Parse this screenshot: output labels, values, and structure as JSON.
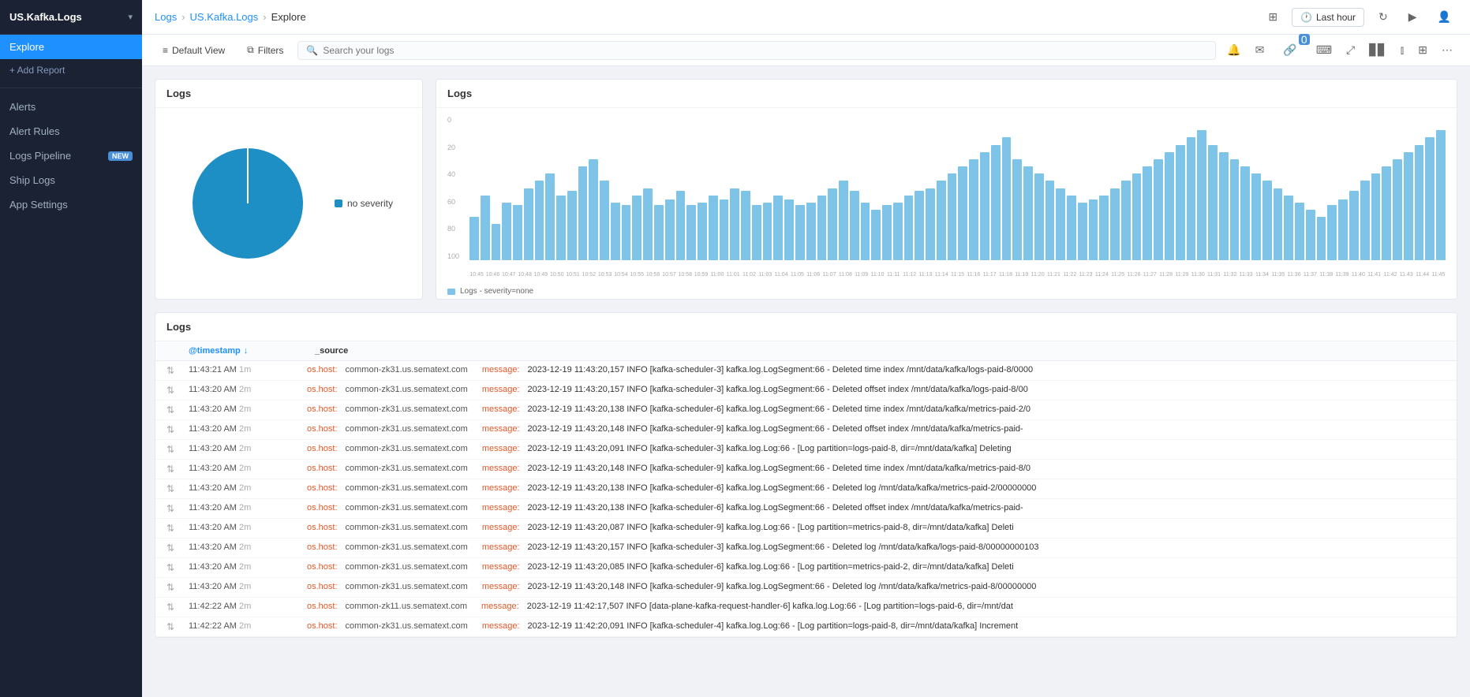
{
  "sidebar": {
    "title": "US.Kafka.Logs",
    "chevron": "▾",
    "active_item": "Explore",
    "add_report": "+ Add Report",
    "nav_items": [
      {
        "label": "Alerts",
        "badge": null
      },
      {
        "label": "Alert Rules",
        "badge": null
      },
      {
        "label": "Logs Pipeline",
        "badge": "NEW"
      },
      {
        "label": "Ship Logs",
        "badge": null
      },
      {
        "label": "App Settings",
        "badge": null
      }
    ]
  },
  "breadcrumb": {
    "logs": "Logs",
    "us_kafka": "US.Kafka.Logs",
    "current": "Explore"
  },
  "topbar_right": {
    "time_filter": "Last hour",
    "refresh_icon": "↻",
    "play_icon": "▶",
    "more_icon": "⋯"
  },
  "toolbar": {
    "default_view": "Default View",
    "filters": "Filters",
    "search_placeholder": "Search your logs"
  },
  "pie_chart": {
    "title": "Logs",
    "legend": [
      {
        "label": "no severity",
        "color": "#1e8fc4"
      }
    ]
  },
  "bar_chart": {
    "title": "Logs",
    "y_labels": [
      "0",
      "20",
      "40",
      "60",
      "80",
      "100"
    ],
    "legend": "Logs - severity=none",
    "bars": [
      30,
      45,
      25,
      40,
      38,
      50,
      55,
      60,
      45,
      48,
      65,
      70,
      55,
      40,
      38,
      45,
      50,
      38,
      42,
      48,
      38,
      40,
      45,
      42,
      50,
      48,
      38,
      40,
      45,
      42,
      38,
      40,
      45,
      50,
      55,
      48,
      40,
      35,
      38,
      40,
      45,
      48,
      50,
      55,
      60,
      65,
      70,
      75,
      80,
      85,
      70,
      65,
      60,
      55,
      50,
      45,
      40,
      42,
      45,
      50,
      55,
      60,
      65,
      70,
      75,
      80,
      85,
      90,
      80,
      75,
      70,
      65,
      60,
      55,
      50,
      45,
      40,
      35,
      30,
      38,
      42,
      48,
      55,
      60,
      65,
      70,
      75,
      80,
      85,
      90
    ],
    "x_labels": [
      "10:45",
      "10:46",
      "10:47",
      "10:48",
      "10:49",
      "10:50",
      "10:51",
      "10:52",
      "10:53",
      "10:54",
      "10:55",
      "10:56",
      "10:57",
      "10:58",
      "10:59",
      "11:00",
      "11:01",
      "11:02",
      "11:03",
      "11:04",
      "11:05",
      "11:06",
      "11:07",
      "11:08",
      "11:09",
      "11:10",
      "11:11",
      "11:12",
      "11:13",
      "11:14",
      "11:15",
      "11:16",
      "11:17",
      "11:18",
      "11:19",
      "11:20",
      "11:21",
      "11:22",
      "11:23",
      "11:24",
      "11:25",
      "11:26",
      "11:27",
      "11:28",
      "11:29",
      "11:30",
      "11:31",
      "11:32",
      "11:33",
      "11:34",
      "11:35",
      "11:36",
      "11:37",
      "11:38",
      "11:39",
      "11:40",
      "11:41",
      "11:42",
      "11:43",
      "11:44",
      "11:45"
    ]
  },
  "logs_table": {
    "title": "Logs",
    "col_timestamp": "@timestamp",
    "col_source": "_source",
    "rows": [
      {
        "ts": "11:43:21 AM",
        "age": "1m",
        "host": "common-zk31.us.sematext.com",
        "msg": "2023-12-19 11:43:20,157 INFO [kafka-scheduler-3] kafka.log.LogSegment:66 - Deleted time index /mnt/data/kafka/logs-paid-8/0000"
      },
      {
        "ts": "11:43:20 AM",
        "age": "2m",
        "host": "common-zk31.us.sematext.com",
        "msg": "2023-12-19 11:43:20,157 INFO [kafka-scheduler-3] kafka.log.LogSegment:66 - Deleted offset index /mnt/data/kafka/logs-paid-8/00"
      },
      {
        "ts": "11:43:20 AM",
        "age": "2m",
        "host": "common-zk31.us.sematext.com",
        "msg": "2023-12-19 11:43:20,138 INFO [kafka-scheduler-6] kafka.log.LogSegment:66 - Deleted time index /mnt/data/kafka/metrics-paid-2/0"
      },
      {
        "ts": "11:43:20 AM",
        "age": "2m",
        "host": "common-zk31.us.sematext.com",
        "msg": "2023-12-19 11:43:20,148 INFO [kafka-scheduler-9] kafka.log.LogSegment:66 - Deleted offset index /mnt/data/kafka/metrics-paid-"
      },
      {
        "ts": "11:43:20 AM",
        "age": "2m",
        "host": "common-zk31.us.sematext.com",
        "msg": "2023-12-19 11:43:20,091 INFO [kafka-scheduler-3] kafka.log.Log:66 - [Log partition=logs-paid-8, dir=/mnt/data/kafka] Deleting"
      },
      {
        "ts": "11:43:20 AM",
        "age": "2m",
        "host": "common-zk31.us.sematext.com",
        "msg": "2023-12-19 11:43:20,148 INFO [kafka-scheduler-9] kafka.log.LogSegment:66 - Deleted time index /mnt/data/kafka/metrics-paid-8/0"
      },
      {
        "ts": "11:43:20 AM",
        "age": "2m",
        "host": "common-zk31.us.sematext.com",
        "msg": "2023-12-19 11:43:20,138 INFO [kafka-scheduler-6] kafka.log.LogSegment:66 - Deleted log /mnt/data/kafka/metrics-paid-2/00000000"
      },
      {
        "ts": "11:43:20 AM",
        "age": "2m",
        "host": "common-zk31.us.sematext.com",
        "msg": "2023-12-19 11:43:20,138 INFO [kafka-scheduler-6] kafka.log.LogSegment:66 - Deleted offset index /mnt/data/kafka/metrics-paid-"
      },
      {
        "ts": "11:43:20 AM",
        "age": "2m",
        "host": "common-zk31.us.sematext.com",
        "msg": "2023-12-19 11:43:20,087 INFO [kafka-scheduler-9] kafka.log.Log:66 - [Log partition=metrics-paid-8, dir=/mnt/data/kafka] Deleti"
      },
      {
        "ts": "11:43:20 AM",
        "age": "2m",
        "host": "common-zk31.us.sematext.com",
        "msg": "2023-12-19 11:43:20,157 INFO [kafka-scheduler-3] kafka.log.LogSegment:66 - Deleted log /mnt/data/kafka/logs-paid-8/00000000103"
      },
      {
        "ts": "11:43:20 AM",
        "age": "2m",
        "host": "common-zk31.us.sematext.com",
        "msg": "2023-12-19 11:43:20,085 INFO [kafka-scheduler-6] kafka.log.Log:66 - [Log partition=metrics-paid-2, dir=/mnt/data/kafka] Deleti"
      },
      {
        "ts": "11:43:20 AM",
        "age": "2m",
        "host": "common-zk31.us.sematext.com",
        "msg": "2023-12-19 11:43:20,148 INFO [kafka-scheduler-9] kafka.log.LogSegment:66 - Deleted log /mnt/data/kafka/metrics-paid-8/00000000"
      },
      {
        "ts": "11:42:22 AM",
        "age": "2m",
        "host": "common-zk11.us.sematext.com",
        "msg": "2023-12-19 11:42:17,507 INFO [data-plane-kafka-request-handler-6] kafka.log.Log:66 - [Log partition=logs-paid-6, dir=/mnt/dat"
      },
      {
        "ts": "11:42:22 AM",
        "age": "2m",
        "host": "common-zk31.us.sematext.com",
        "msg": "2023-12-19 11:42:20,091 INFO [kafka-scheduler-4] kafka.log.Log:66 - [Log partition=logs-paid-8, dir=/mnt/data/kafka] Increment"
      }
    ]
  },
  "colors": {
    "accent": "#1e90ff",
    "pie_main": "#1e8fc4",
    "bar_main": "#7dc4e8",
    "host_color": "#e05a2b",
    "message_color": "#e05a2b"
  }
}
